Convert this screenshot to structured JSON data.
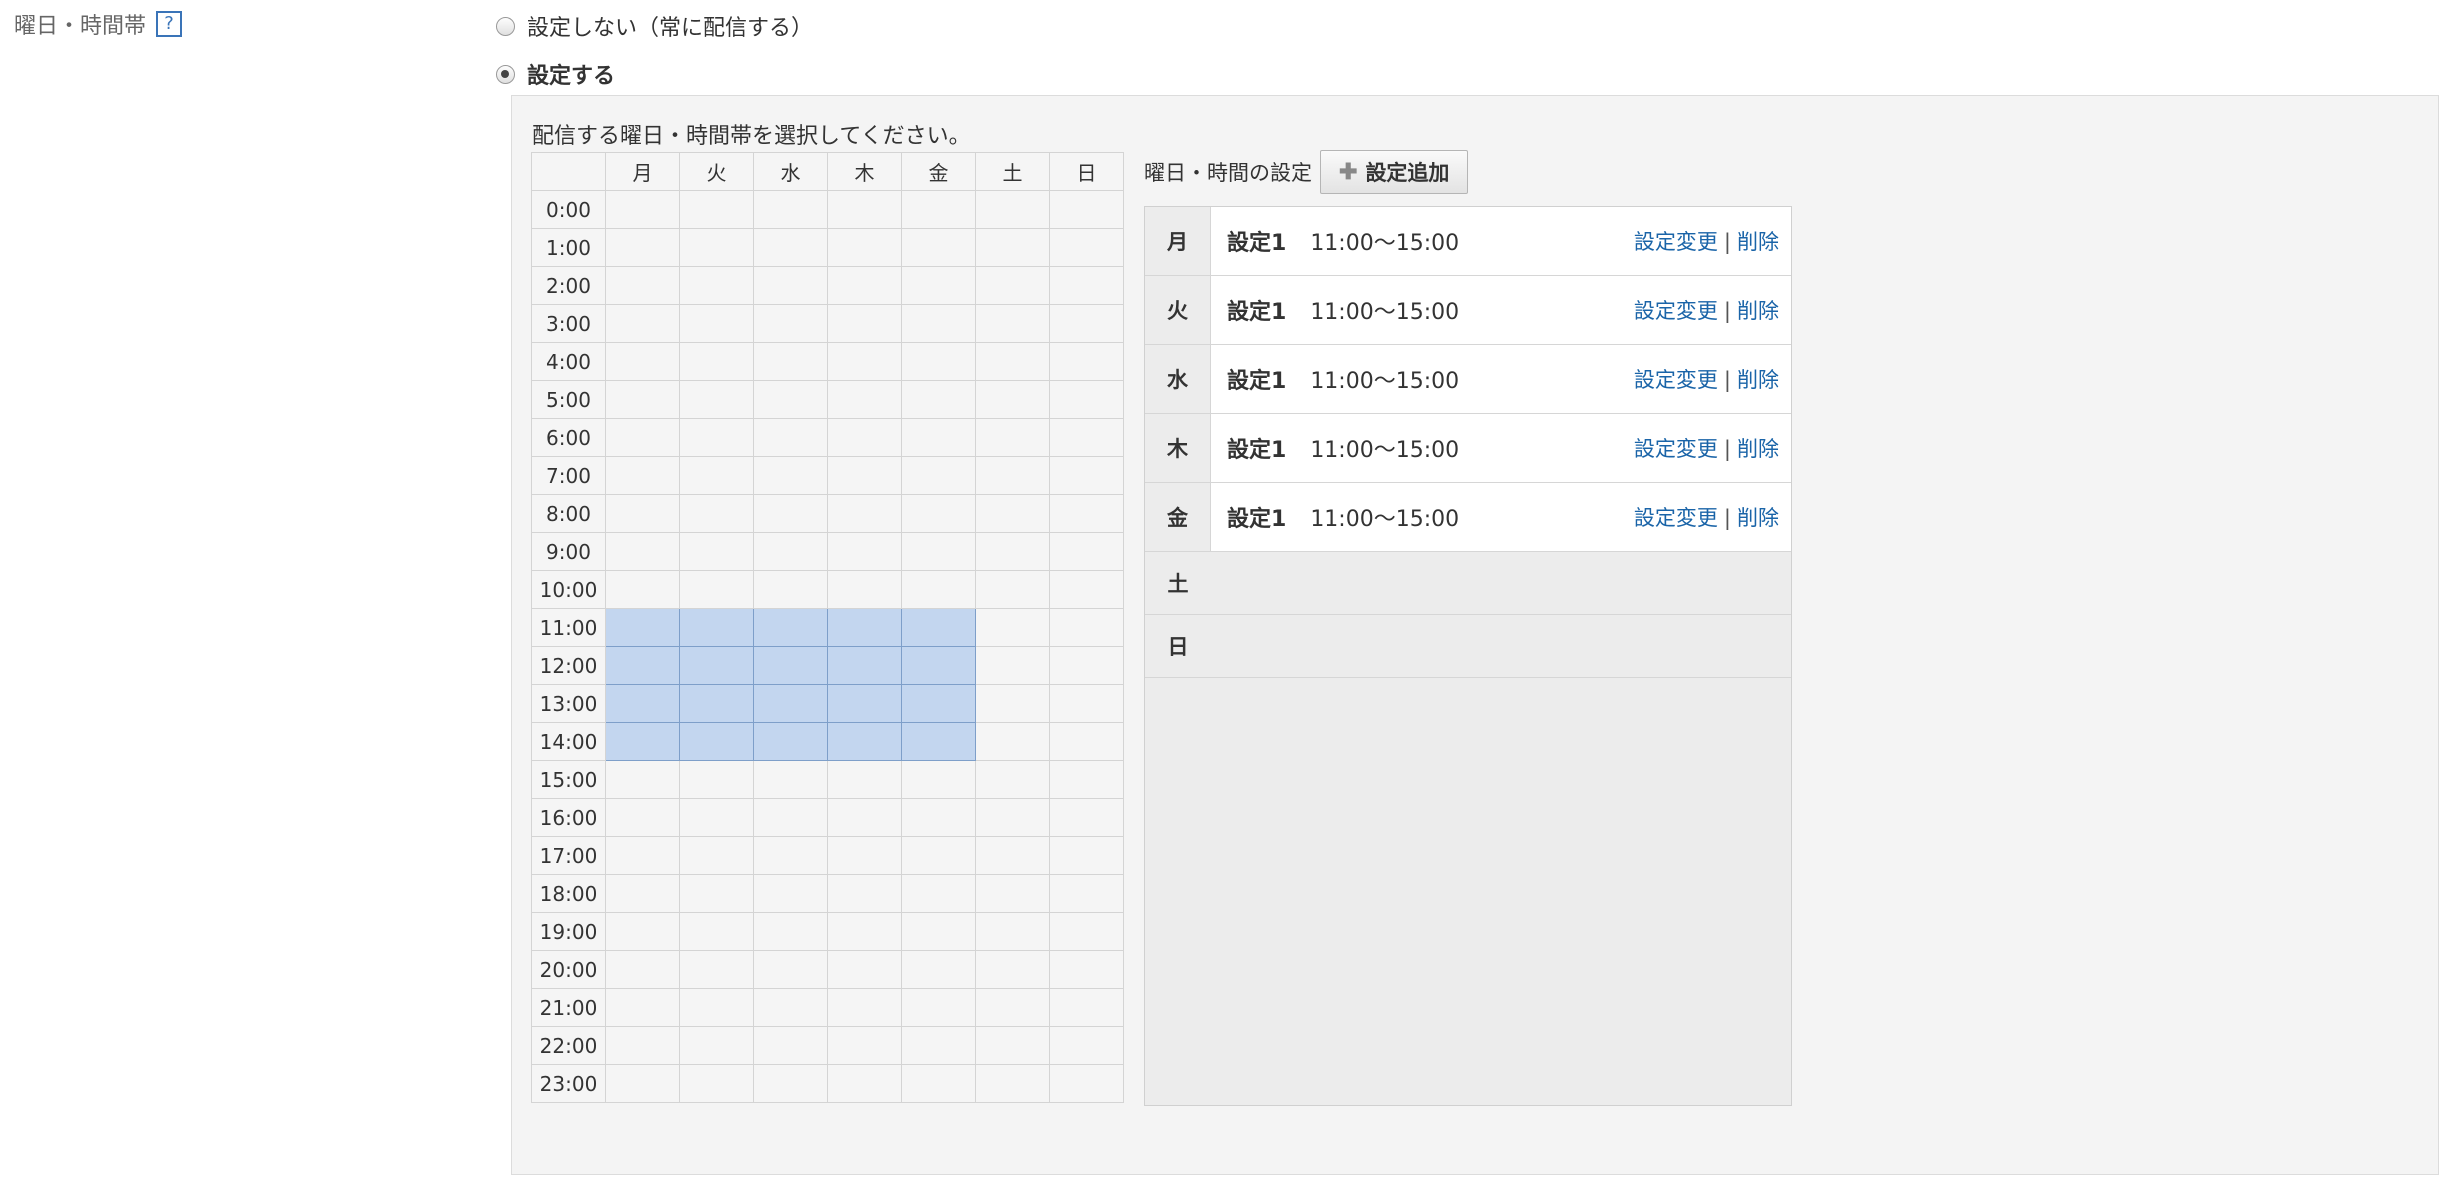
{
  "field_label": "曜日・時間帯",
  "help_icon_text": "?",
  "radio_off_label": "設定しない（常に配信する）",
  "radio_on_label": "設定する",
  "instruction": "配信する曜日・時間帯を選択してください。",
  "grid": {
    "days": [
      "月",
      "火",
      "水",
      "木",
      "金",
      "土",
      "日"
    ],
    "hours": [
      "0:00",
      "1:00",
      "2:00",
      "3:00",
      "4:00",
      "5:00",
      "6:00",
      "7:00",
      "8:00",
      "9:00",
      "10:00",
      "11:00",
      "12:00",
      "13:00",
      "14:00",
      "15:00",
      "16:00",
      "17:00",
      "18:00",
      "19:00",
      "20:00",
      "21:00",
      "22:00",
      "23:00"
    ],
    "selection_color": "#c3d6ef",
    "selected_days": [
      "月",
      "火",
      "水",
      "木",
      "金"
    ],
    "selected_hours": [
      "11:00",
      "12:00",
      "13:00",
      "14:00"
    ]
  },
  "settings": {
    "heading": "曜日・時間の設定",
    "add_button_label": "設定追加",
    "rows": [
      {
        "day": "月",
        "name": "設定1",
        "time": "11:00〜15:00",
        "edit": "設定変更",
        "sep": "|",
        "delete": "削除"
      },
      {
        "day": "火",
        "name": "設定1",
        "time": "11:00〜15:00",
        "edit": "設定変更",
        "sep": "|",
        "delete": "削除"
      },
      {
        "day": "水",
        "name": "設定1",
        "time": "11:00〜15:00",
        "edit": "設定変更",
        "sep": "|",
        "delete": "削除"
      },
      {
        "day": "木",
        "name": "設定1",
        "time": "11:00〜15:00",
        "edit": "設定変更",
        "sep": "|",
        "delete": "削除"
      },
      {
        "day": "金",
        "name": "設定1",
        "time": "11:00〜15:00",
        "edit": "設定変更",
        "sep": "|",
        "delete": "削除"
      }
    ],
    "empty_days": [
      "土",
      "日"
    ]
  },
  "colors": {
    "link": "#1a64a8",
    "panel_bg": "#f4f4f4",
    "selection": "#c3d6ef"
  }
}
